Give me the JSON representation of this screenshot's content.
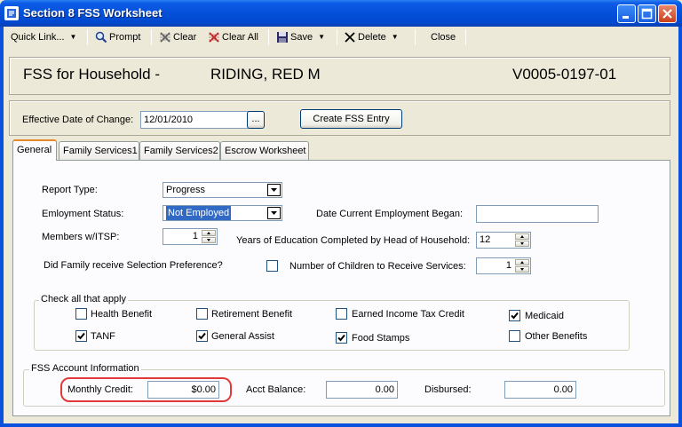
{
  "window": {
    "title": "Section 8 FSS Worksheet"
  },
  "toolbar": {
    "quick_link": "Quick Link...",
    "prompt": "Prompt",
    "clear": "Clear",
    "clear_all": "Clear All",
    "save": "Save",
    "delete": "Delete",
    "close": "Close"
  },
  "header": {
    "label": "FSS for Household -",
    "name": "RIDING, RED M",
    "id": "V0005-0197-01"
  },
  "effective": {
    "label": "Effective Date of Change:",
    "value": "12/01/2010",
    "browse": "...",
    "create_button": "Create FSS Entry"
  },
  "tabs": [
    "General",
    "Family Services1",
    "Family Services2",
    "Escrow Worksheet"
  ],
  "general": {
    "report_type_label": "Report Type:",
    "report_type_value": "Progress",
    "employment_label": "Emloyment Status:",
    "employment_value": "Not Employed",
    "date_employment_label": "Date Current Employment Began:",
    "date_employment_value": "",
    "members_label": "Members w/ITSP:",
    "members_value": "1",
    "years_edu_label": "Years of Education Completed by Head of Household:",
    "years_edu_value": "12",
    "selection_pref_label": "Did Family receive Selection Preference?",
    "selection_pref_checked": false,
    "children_label": "Number of Children to Receive Services:",
    "children_value": "1"
  },
  "check_all": {
    "title": "Check all that apply",
    "items": [
      {
        "label": "Health Benefit",
        "checked": false
      },
      {
        "label": "Retirement Benefit",
        "checked": false
      },
      {
        "label": "Earned Income Tax Credit",
        "checked": false
      },
      {
        "label": "Medicaid",
        "checked": true
      },
      {
        "label": "TANF",
        "checked": true
      },
      {
        "label": "General Assist",
        "checked": true
      },
      {
        "label": "Food Stamps",
        "checked": true
      },
      {
        "label": "Other Benefits",
        "checked": false
      }
    ]
  },
  "fss_account": {
    "title": "FSS Account Information",
    "monthly_credit_label": "Monthly Credit:",
    "monthly_credit_value": "$0.00",
    "acct_balance_label": "Acct Balance:",
    "acct_balance_value": "0.00",
    "disbursed_label": "Disbursed:",
    "disbursed_value": "0.00"
  },
  "colors": {
    "title_bar": "#0550d9",
    "highlight": "#e23a3a",
    "selection": "#316ac5"
  }
}
